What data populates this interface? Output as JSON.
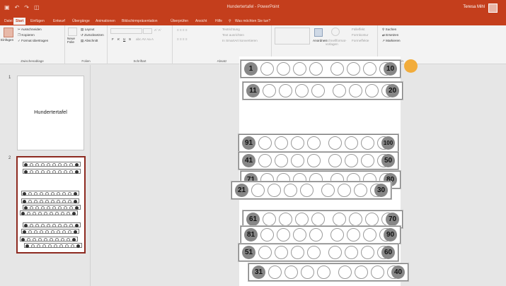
{
  "window": {
    "title": "Hundertertafel - PowerPoint",
    "user": "Teresa Mihl"
  },
  "qat": [
    "▣",
    "↶",
    "↷",
    "◫"
  ],
  "tabs": [
    "Datei",
    "Start",
    "Einfügen",
    "Entwurf",
    "Übergänge",
    "Animationen",
    "Bildschirmpräsentation",
    "Überprüfen",
    "Ansicht",
    "Hilfe",
    "Was möchten Sie tun?"
  ],
  "active_tab": "Start",
  "ribbon": {
    "clipboard": {
      "paste": "Einfügen",
      "cut": "Ausschneiden",
      "copy": "Kopieren",
      "format_painter": "Format übertragen",
      "label": "Zwischenablage"
    },
    "slides": {
      "new_slide": "Neue Folie",
      "layout": "Layout",
      "reset": "Zurücksetzen",
      "section": "Abschnitt",
      "label": "Folien"
    },
    "font": {
      "bold": "F",
      "italic": "K",
      "underline": "U",
      "strike": "S",
      "label": "Schriftart"
    },
    "paragraph": {
      "direction": "Textrichtung",
      "align": "Text ausrichten",
      "smartart": "In SmartArt konvertieren",
      "label": "Absatz"
    },
    "drawing": {
      "arrange": "Anordnen",
      "quick_styles": "Schnellformat-vorlagen",
      "fill": "Fülleffekt",
      "outline": "Formkontur",
      "effects": "Formeffekte",
      "label": "Zeichnen"
    },
    "editing": {
      "find": "Suchen",
      "replace": "Ersetzen",
      "select": "Markieren",
      "label": "Bearbeiten"
    }
  },
  "slides_panel": [
    {
      "number": "1",
      "title": "Hundertertafel"
    },
    {
      "number": "2"
    }
  ],
  "slide_rows": [
    {
      "start": "1",
      "end": "10"
    },
    {
      "start": "11",
      "end": "20"
    },
    {
      "start": "91",
      "end": "100"
    },
    {
      "start": "41",
      "end": "50"
    },
    {
      "start": "71",
      "end": "80"
    },
    {
      "start": "21",
      "end": "30"
    },
    {
      "start": "61",
      "end": "70"
    },
    {
      "start": "81",
      "end": "90"
    },
    {
      "start": "51",
      "end": "60"
    },
    {
      "start": "31",
      "end": "40"
    }
  ],
  "colors": {
    "accent": "#c43e1c",
    "badge": "#878787",
    "marker": "#f2ac3b"
  }
}
